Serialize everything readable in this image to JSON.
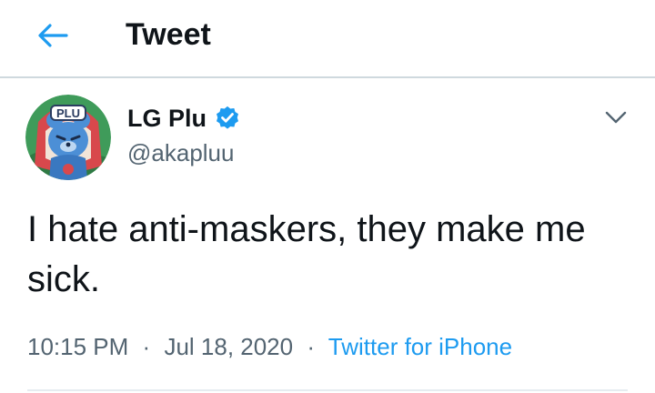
{
  "header": {
    "back_icon": "arrow-left-icon",
    "title": "Tweet"
  },
  "tweet": {
    "author": {
      "display_name": "LG Plu",
      "handle": "@akapluu",
      "verified": true,
      "avatar_badge_text": "PLU"
    },
    "text": "I hate anti-maskers, they make me sick.",
    "time": "10:15 PM",
    "date": "Jul 18, 2020",
    "separator": "·",
    "source": "Twitter for iPhone"
  },
  "colors": {
    "accent": "#1d9bf0",
    "text_primary": "#0f1419",
    "text_secondary": "#536471",
    "divider": "#cfd9de"
  }
}
